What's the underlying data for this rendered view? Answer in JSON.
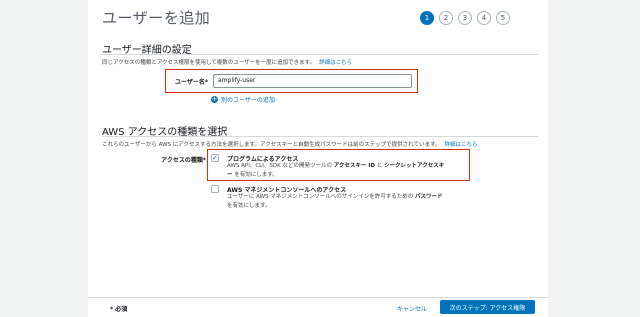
{
  "page": {
    "title": "ユーザーを追加",
    "steps": [
      "1",
      "2",
      "3",
      "4",
      "5"
    ]
  },
  "user_details": {
    "heading": "ユーザー詳細の設定",
    "description": "同じアクセスの種類とアクセス権限を使用して複数のユーザーを一度に追加できます。",
    "more_link": "詳細はこちら",
    "user_name_label": "ユーザー名*",
    "user_name_value": "amplify-user",
    "add_another_user": "別のユーザーの追加"
  },
  "access_type": {
    "heading": "AWS アクセスの種類を選択",
    "description": "これらのユーザーから AWS にアクセスする方法を選択します。アクセスキーと自動生成パスワードは前のステップで提供されています。",
    "more_link": "詳細はこちら",
    "label": "アクセスの種類*",
    "programmatic": {
      "checked": true,
      "title": "プログラムによるアクセス",
      "line1_pre": "AWS API、CLI、SDK などの開発ツールの",
      "line1_bold1": "アクセスキー ID",
      "line1_mid": "と",
      "line1_bold2": "シークレットアクセスキ",
      "line2_bold": "ー",
      "line2_post": "を有効にします。"
    },
    "console": {
      "checked": false,
      "title": "AWS マネジメントコンソールへのアクセス",
      "line1_pre": "ユーザーに AWS マネジメントコンソールへのサインインを許可するための",
      "line1_bold": "パスワード",
      "line2": "を有効にします。"
    }
  },
  "footer": {
    "required": "* 必須",
    "cancel": "キャンセル",
    "next": "次のステップ: アクセス権限"
  }
}
